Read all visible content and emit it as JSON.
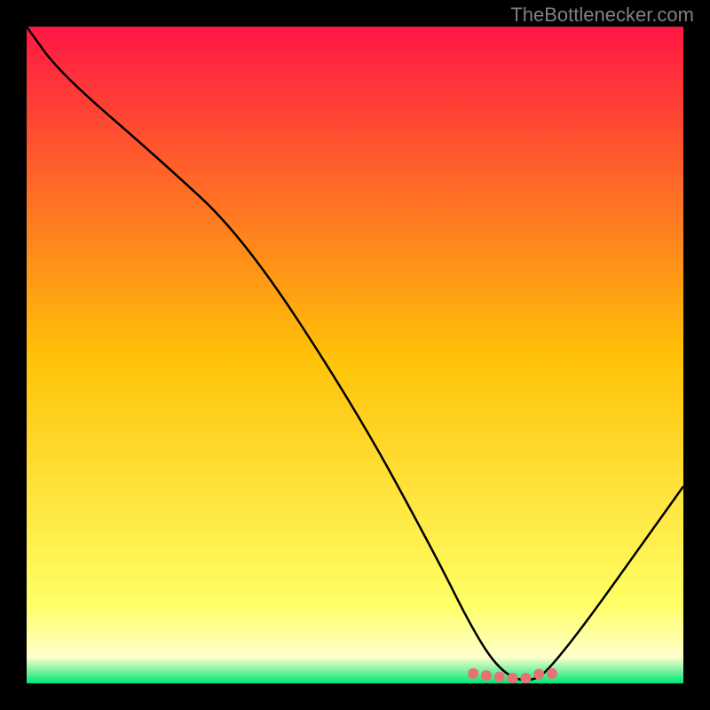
{
  "watermark": "TheBottlenecker.com",
  "chart_data": {
    "type": "line",
    "title": "",
    "xlabel": "",
    "ylabel": "",
    "xlim": [
      0,
      100
    ],
    "ylim": [
      0,
      100
    ],
    "gradient_stops": [
      {
        "offset": 0,
        "color": "#ff1744"
      },
      {
        "offset": 50,
        "color": "#ffc107"
      },
      {
        "offset": 88,
        "color": "#ffff66"
      },
      {
        "offset": 96,
        "color": "#ffffcc"
      },
      {
        "offset": 100,
        "color": "#00e676"
      }
    ],
    "series": [
      {
        "name": "bottleneck-curve",
        "x": [
          0,
          5,
          20,
          33,
          50,
          62,
          68,
          72,
          76,
          80,
          100
        ],
        "y": [
          100,
          93,
          80,
          68,
          42,
          20,
          8,
          2,
          0,
          2,
          30
        ]
      }
    ],
    "markers": {
      "name": "optimal-range",
      "color": "#e57373",
      "points": [
        {
          "x": 68,
          "y": 1.5
        },
        {
          "x": 70,
          "y": 1.2
        },
        {
          "x": 72,
          "y": 1.0
        },
        {
          "x": 74,
          "y": 0.8
        },
        {
          "x": 76,
          "y": 0.8
        },
        {
          "x": 78,
          "y": 1.4
        },
        {
          "x": 80,
          "y": 1.5
        }
      ]
    }
  }
}
